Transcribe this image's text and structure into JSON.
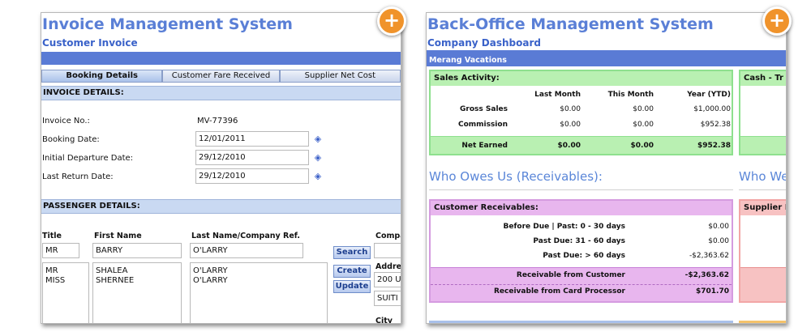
{
  "left_panel": {
    "title": "Invoice Management System",
    "subtitle": "Customer Invoice",
    "tabs": [
      "Booking Details",
      "Customer Fare Received",
      "Supplier Net Cost"
    ],
    "invoice_section": {
      "header": "INVOICE DETAILS:",
      "invoice_no_label": "Invoice No.:",
      "invoice_no": "MV-77396",
      "booking_date_label": "Booking Date:",
      "booking_date": "12/01/2011",
      "departure_label": "Initial Departure Date:",
      "departure_date": "29/12/2010",
      "return_label": "Last Return Date:",
      "return_date": "29/12/2010"
    },
    "passenger_section": {
      "header": "PASSENGER DETAILS:",
      "col_title": "Title",
      "col_first": "First Name",
      "col_last": "Last Name/Company Ref.",
      "col_company": "Compa",
      "title_value": "MR",
      "first_value": "BARRY",
      "last_value": "O'LARRY",
      "titles_list": "MR\nMISS",
      "first_list": "SHALEA\nSHERNEE",
      "last_list": "O'LARRY\nO'LARRY",
      "search_button": "Search",
      "create_button": "Create",
      "update_button": "Update",
      "address_label": "Addre",
      "address_line1": "200 U",
      "address_line2": "SUITI",
      "city_label": "City"
    }
  },
  "right_panel": {
    "title": "Back-Office Management System",
    "subtitle": "Company Dashboard",
    "company": "Merang Vacations",
    "sales": {
      "header": "Sales Activity:",
      "col_last": "Last Month",
      "col_this": "This Month",
      "col_year": "Year (YTD)",
      "rows": [
        {
          "label": "Gross Sales",
          "last": "$0.00",
          "this": "$0.00",
          "year": "$1,000.00"
        },
        {
          "label": "Commission",
          "last": "$0.00",
          "this": "$0.00",
          "year": "$952.38"
        }
      ],
      "net_label": "Net Earned",
      "net_last": "$0.00",
      "net_this": "$0.00",
      "net_year": "$952.38"
    },
    "cash_header": "Cash - Tr",
    "receivables_title": "Who Owes Us (Receivables):",
    "who_we_title": "Who We",
    "customer_receivables": {
      "header": "Customer Receivables:",
      "rows": [
        {
          "label": "Before Due | Past: 0 - 30 days",
          "value": "$0.00"
        },
        {
          "label": "Past Due: 31 - 60 days",
          "value": "$0.00"
        },
        {
          "label": "Past Due: > 60 days",
          "value": "-$2,363.62"
        }
      ],
      "from_customer_label": "Receivable from Customer",
      "from_customer_value": "-$2,363.62",
      "from_processor_label": "Receivable from Card Processor",
      "from_processor_value": "$701.70"
    },
    "supplier_header": "Supplier P"
  },
  "plus_icon": "+",
  "colors": {
    "accent": "#5a7bd5",
    "title": "#5a7fd6",
    "plus": "#f0932b"
  }
}
